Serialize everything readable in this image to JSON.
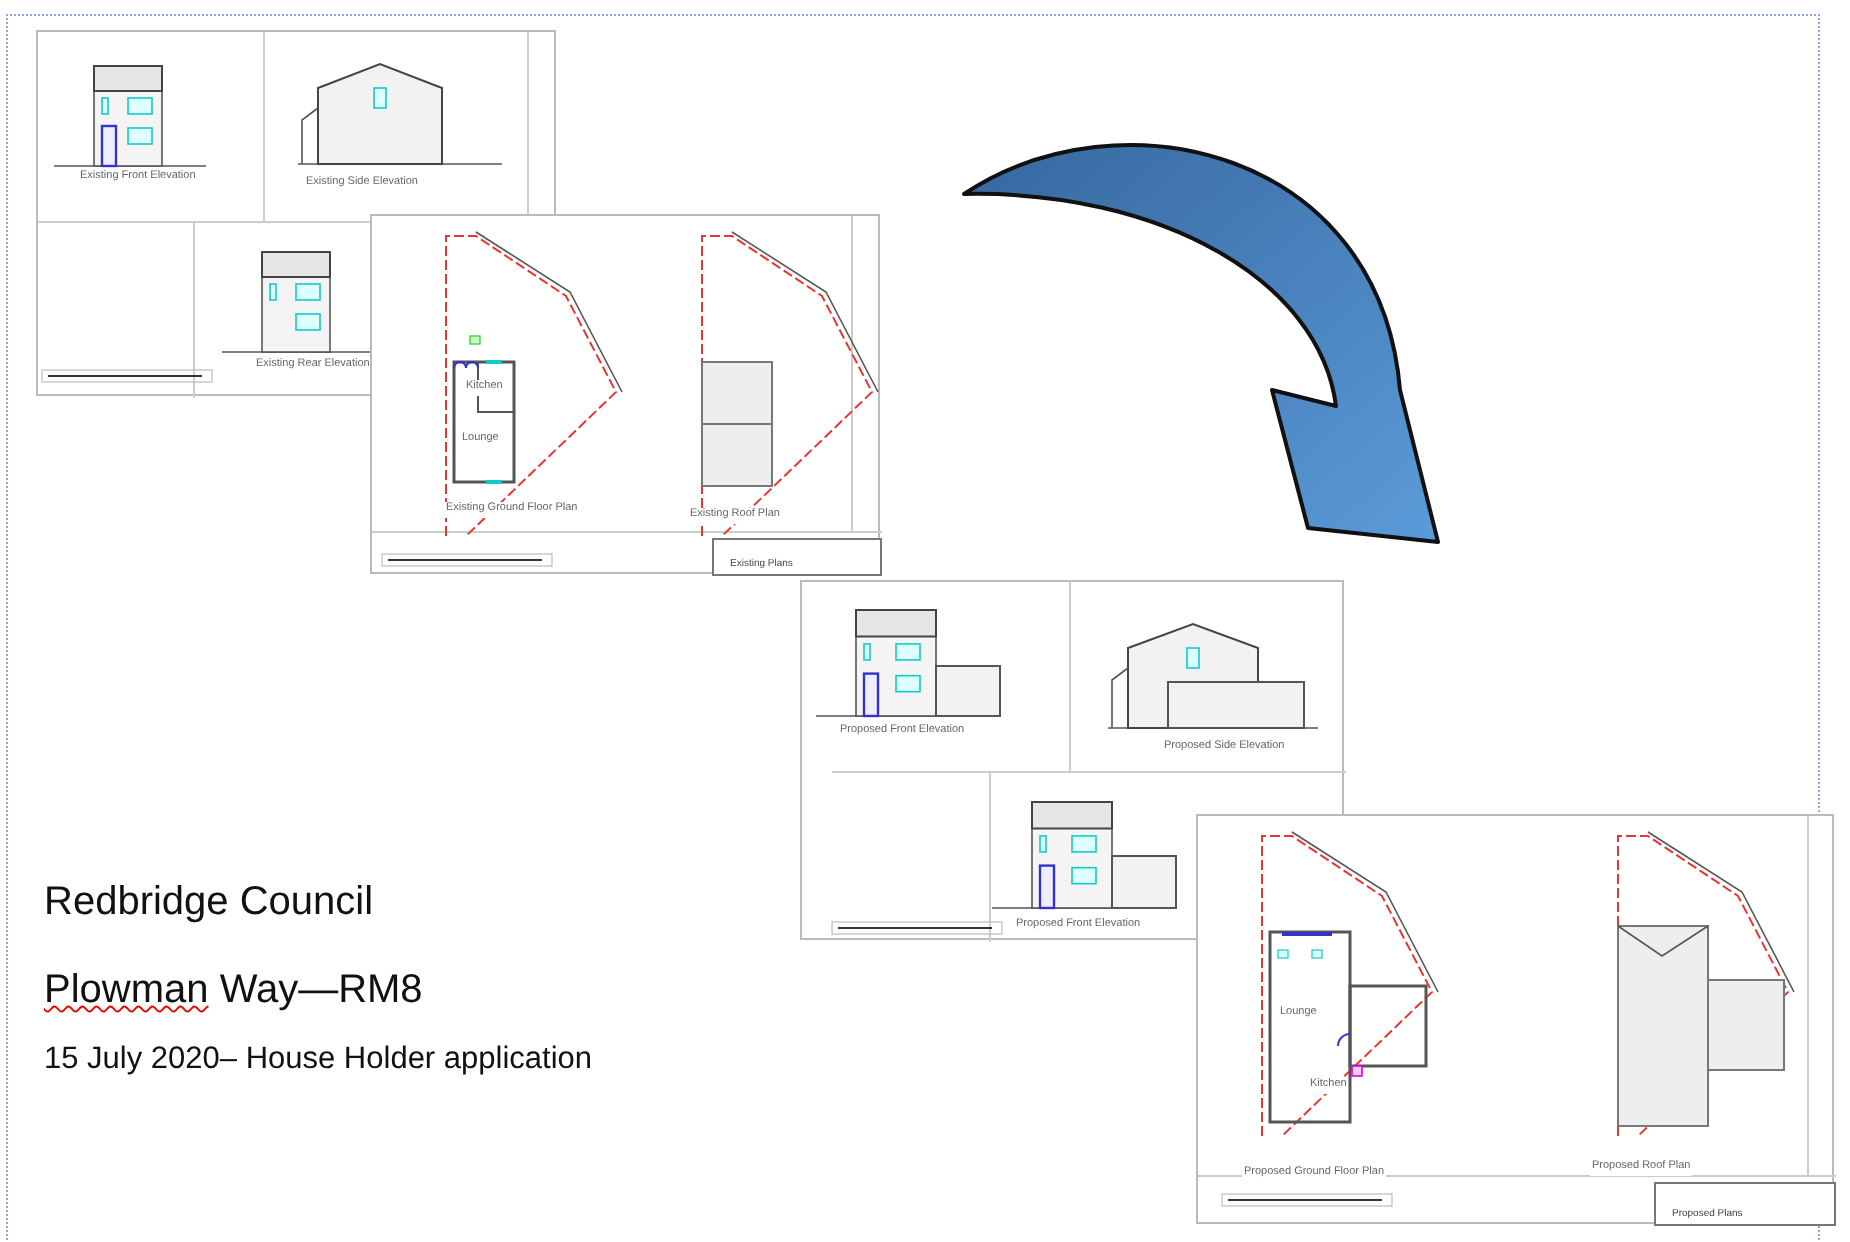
{
  "sheets": [
    {
      "kind": "existing_elevations",
      "labels": [
        "Existing Front Elevation",
        "Existing Side Elevation",
        "Existing Rear Elevation"
      ]
    },
    {
      "kind": "existing_plans",
      "labels": [
        "Kitchen",
        "Lounge",
        "Existing Ground Floor Plan",
        "Existing Roof Plan"
      ],
      "title_block": "Existing Plans"
    },
    {
      "kind": "proposed_elevations",
      "labels": [
        "Proposed Front Elevation",
        "Proposed Side Elevation",
        "Proposed Front Elevation"
      ]
    },
    {
      "kind": "proposed_plans",
      "labels": [
        "Lounge",
        "Kitchen",
        "Proposed Ground Floor Plan",
        "Proposed Roof Plan"
      ],
      "title_block": "Proposed Plans"
    }
  ],
  "heading": "Redbridge Council",
  "subheading": {
    "text": "Plowman Way—RM8",
    "spellcheck_underline": true
  },
  "date_line": "15 July 2020– House Holder application"
}
